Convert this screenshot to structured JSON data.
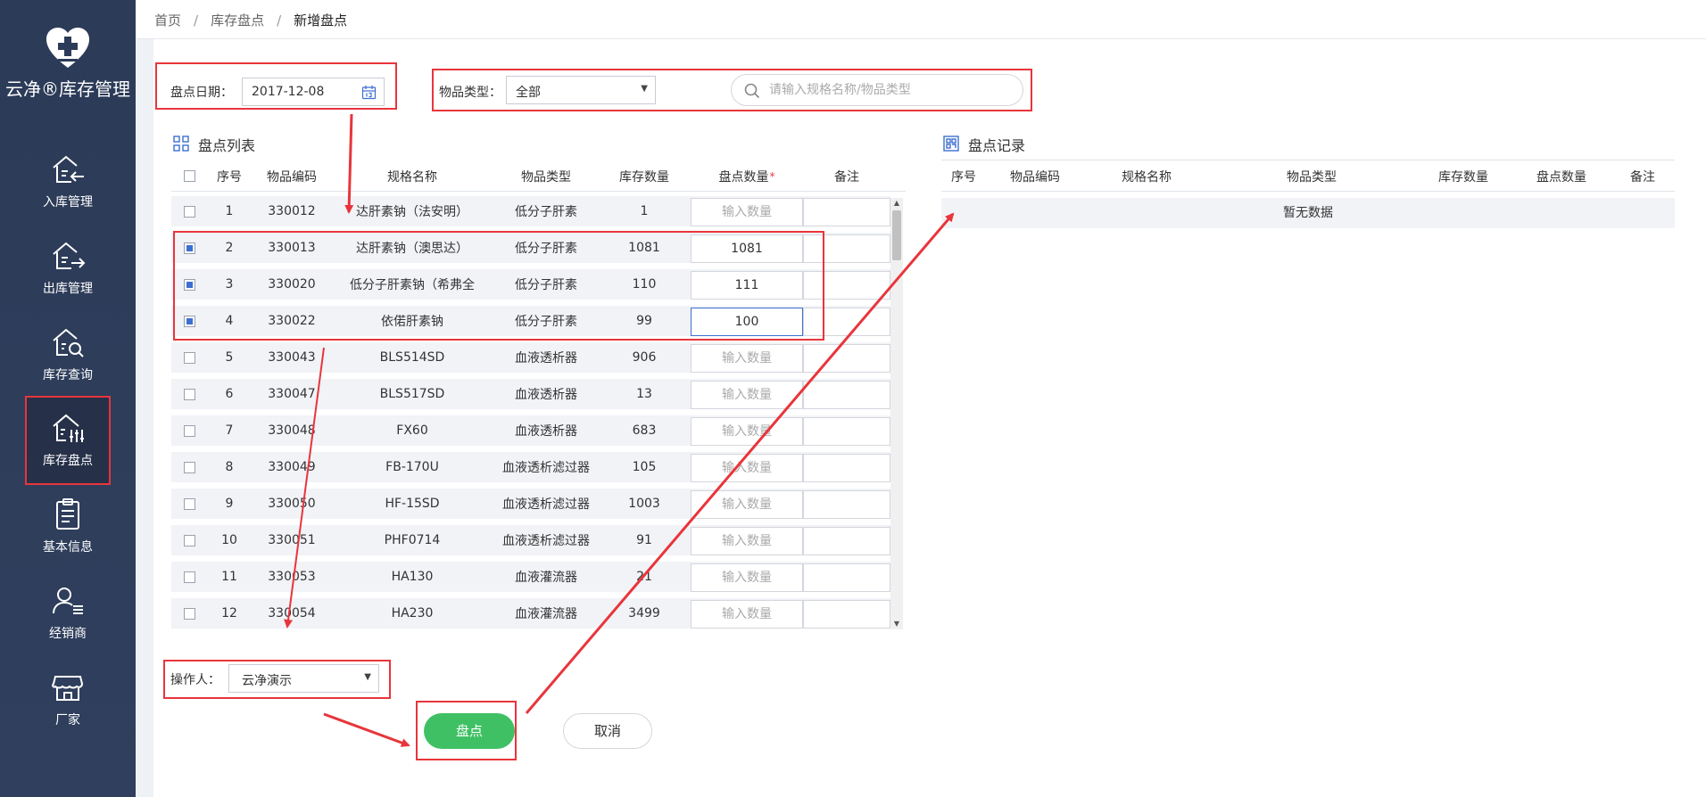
{
  "brand": {
    "title": "云净®库存管理"
  },
  "nav": [
    {
      "label": "入库管理",
      "icon": "inbound-house-icon"
    },
    {
      "label": "出库管理",
      "icon": "outbound-house-icon"
    },
    {
      "label": "库存查询",
      "icon": "stock-search-icon"
    },
    {
      "label": "库存盘点",
      "icon": "stock-count-icon",
      "active": true
    },
    {
      "label": "基本信息",
      "icon": "clipboard-icon"
    },
    {
      "label": "经销商",
      "icon": "dealer-icon"
    },
    {
      "label": "厂家",
      "icon": "store-icon"
    }
  ],
  "breadcrumb": {
    "home": "首页",
    "parent": "库存盘点",
    "current": "新增盘点",
    "sep": "/"
  },
  "filters": {
    "date_label": "盘点日期：",
    "date_value": "2017-12-08",
    "type_label": "物品类型：",
    "type_value": "全部",
    "search_placeholder": "请输入规格名称/物品类型"
  },
  "list": {
    "title": "盘点列表",
    "headers": [
      "序号",
      "物品编码",
      "规格名称",
      "物品类型",
      "库存数量",
      "盘点数量",
      "备注"
    ],
    "required_mark": "*",
    "qty_placeholder": "输入数量",
    "rows": [
      {
        "no": "1",
        "code": "330012",
        "name": "达肝素钠（法安明）",
        "type": "低分子肝素",
        "stock": "1",
        "qty": "",
        "checked": false
      },
      {
        "no": "2",
        "code": "330013",
        "name": "达肝素钠（澳思达）",
        "type": "低分子肝素",
        "stock": "1081",
        "qty": "1081",
        "checked": true
      },
      {
        "no": "3",
        "code": "330020",
        "name": "低分子肝素钠（希弗全",
        "type": "低分子肝素",
        "stock": "110",
        "qty": "111",
        "checked": true
      },
      {
        "no": "4",
        "code": "330022",
        "name": "依偌肝素钠",
        "type": "低分子肝素",
        "stock": "99",
        "qty": "100",
        "checked": true,
        "focus": true
      },
      {
        "no": "5",
        "code": "330043",
        "name": "BLS514SD",
        "type": "血液透析器",
        "stock": "906",
        "qty": "",
        "checked": false
      },
      {
        "no": "6",
        "code": "330047",
        "name": "BLS517SD",
        "type": "血液透析器",
        "stock": "13",
        "qty": "",
        "checked": false
      },
      {
        "no": "7",
        "code": "330048",
        "name": "FX60",
        "type": "血液透析器",
        "stock": "683",
        "qty": "",
        "checked": false
      },
      {
        "no": "8",
        "code": "330049",
        "name": "FB-170U",
        "type": "血液透析滤过器",
        "stock": "105",
        "qty": "",
        "checked": false
      },
      {
        "no": "9",
        "code": "330050",
        "name": "HF-15SD",
        "type": "血液透析滤过器",
        "stock": "1003",
        "qty": "",
        "checked": false
      },
      {
        "no": "10",
        "code": "330051",
        "name": "PHF0714",
        "type": "血液透析滤过器",
        "stock": "91",
        "qty": "",
        "checked": false
      },
      {
        "no": "11",
        "code": "330053",
        "name": "HA130",
        "type": "血液灌流器",
        "stock": "21",
        "qty": "",
        "checked": false
      },
      {
        "no": "12",
        "code": "330054",
        "name": "HA230",
        "type": "血液灌流器",
        "stock": "3499",
        "qty": "",
        "checked": false
      }
    ]
  },
  "records": {
    "title": "盘点记录",
    "headers": [
      "序号",
      "物品编码",
      "规格名称",
      "物品类型",
      "库存数量",
      "盘点数量",
      "备注"
    ],
    "empty_text": "暂无数据"
  },
  "operator": {
    "label": "操作人：",
    "value": "云净演示"
  },
  "actions": {
    "submit": "盘点",
    "cancel": "取消"
  },
  "colors": {
    "accent_green": "#3fc064",
    "annotation_red": "#e8353b",
    "sidebar": "#2c3b57",
    "check_blue": "#3d6fd1"
  }
}
